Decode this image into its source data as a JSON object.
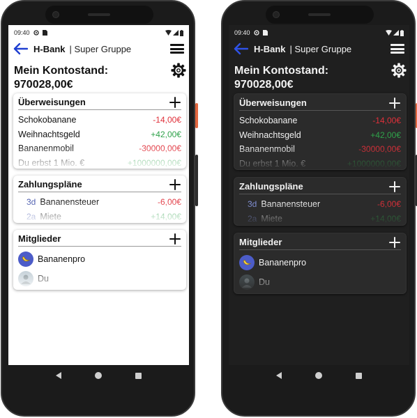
{
  "colors": {
    "accent": "#1f3fd1",
    "negative": "#e0303a",
    "positive": "#2fa24a",
    "interval": "#3d4fa8",
    "light_background": "#ffffff",
    "dark_background": "#1f1f1f",
    "dark_card": "#2b2b2b"
  },
  "status_bar": {
    "time": "09:40",
    "icons": [
      "settings-sync-icon",
      "sim-card-icon",
      "wifi-icon",
      "signal-icon",
      "battery-icon"
    ]
  },
  "app_bar": {
    "brand": "H-Bank",
    "separator_group": "| Super Gruppe",
    "back_icon": "arrow-left-icon",
    "menu_icon": "hamburger-menu-icon"
  },
  "balance": {
    "label": "Mein Kontostand:",
    "value": "970028,00€",
    "settings_icon": "gear-icon"
  },
  "transfers": {
    "title": "Überweisungen",
    "add_icon": "plus-icon",
    "items": [
      {
        "name": "Schokobanane",
        "amount": "-14,00€",
        "type": "negative"
      },
      {
        "name": "Weihnachtsgeld",
        "amount": "+42,00€",
        "type": "positive"
      },
      {
        "name": "Bananenmobil",
        "amount": "-30000,00€",
        "type": "negative"
      },
      {
        "name": "Du erbst 1 Mio. €",
        "amount": "+1000000,00€",
        "type": "positive"
      }
    ]
  },
  "payment_plans": {
    "title": "Zahlungspläne",
    "add_icon": "plus-icon",
    "items": [
      {
        "interval": "3d",
        "name": "Bananensteuer",
        "amount": "-6,00€",
        "type": "negative"
      },
      {
        "interval": "2a",
        "name": "Miete",
        "amount": "+14,00€",
        "type": "positive"
      }
    ]
  },
  "members": {
    "title": "Mitglieder",
    "add_icon": "plus-icon",
    "items": [
      {
        "name": "Bananenpro",
        "avatar": "banana-avatar"
      },
      {
        "name": "Du",
        "avatar": "user-avatar"
      }
    ]
  },
  "nav_bar": {
    "icons": [
      "nav-back-icon",
      "nav-home-icon",
      "nav-recents-icon"
    ]
  }
}
